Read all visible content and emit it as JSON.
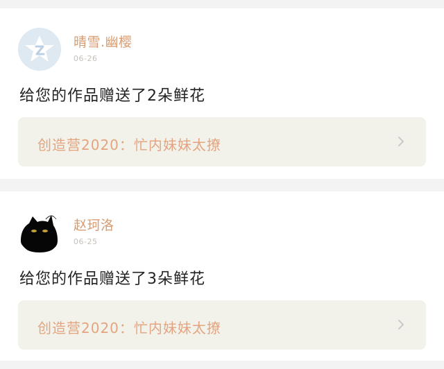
{
  "feed": {
    "items": [
      {
        "user": "晴雪.幽樱",
        "date": "06-26",
        "message": "给您的作品赠送了2朵鲜花",
        "work_title": "创造营2020：忙内妹妹太撩",
        "avatar_icon": "qq-default-avatar-icon"
      },
      {
        "user": "赵珂洛",
        "date": "06-25",
        "message": "给您的作品赠送了3朵鲜花",
        "work_title": "创造营2020：忙内妹妹太撩",
        "avatar_icon": "black-cat-avatar-icon"
      }
    ]
  },
  "colors": {
    "username": "#d79c72",
    "work_title": "#e3a47f",
    "work_background": "#f3f2ea",
    "page_background": "#f3f3f3"
  }
}
